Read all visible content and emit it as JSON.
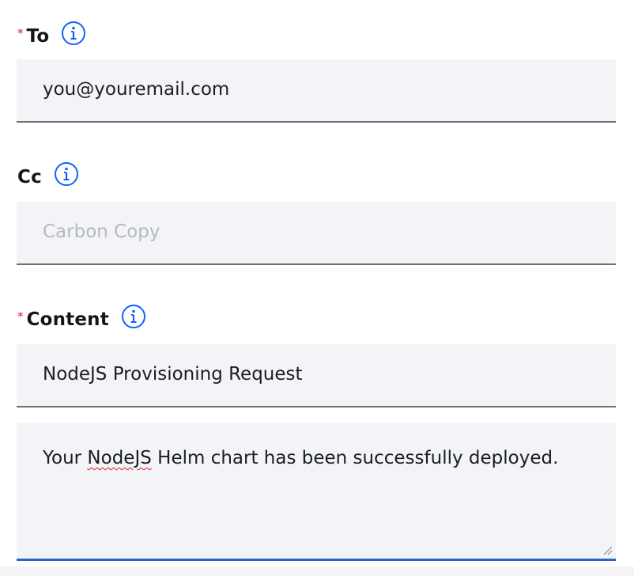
{
  "to": {
    "required_marker": "*",
    "label": "To",
    "icon": "info-icon",
    "value": "you@youremail.com"
  },
  "cc": {
    "label": "Cc",
    "icon": "info-icon",
    "placeholder": "Carbon Copy",
    "value": ""
  },
  "content": {
    "required_marker": "*",
    "label": "Content",
    "icon": "info-icon",
    "subject": "NodeJS Provisioning Request",
    "body_prefix": "Your ",
    "body_misspelled": "NodeJS",
    "body_suffix": " Helm chart has been successfully deployed."
  },
  "colors": {
    "required": "#da1e28",
    "info_icon": "#0f62fe",
    "field_background": "#f3f4f8",
    "focus_border": "#2d63c8"
  }
}
